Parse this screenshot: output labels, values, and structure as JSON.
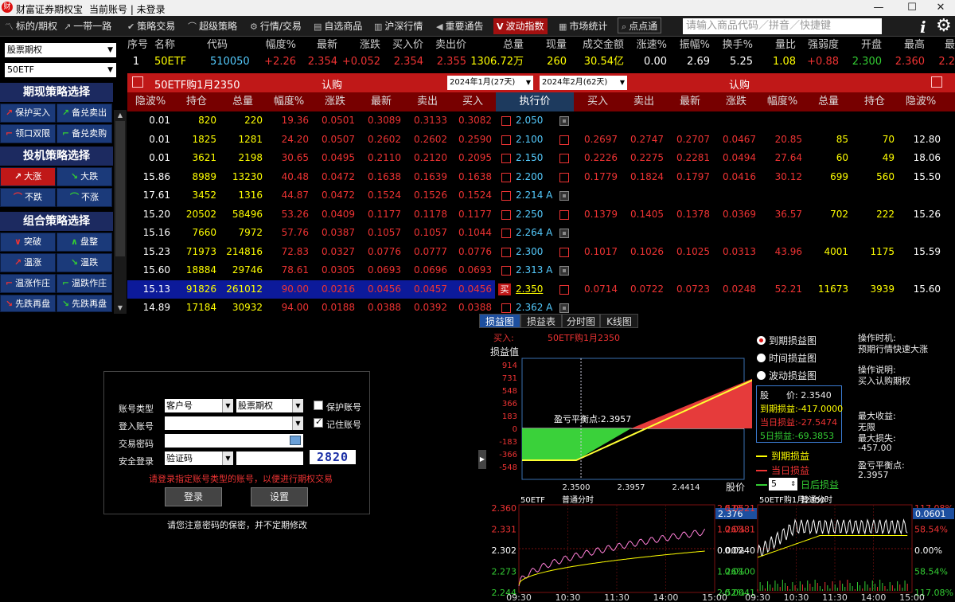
{
  "titlebar": {
    "app_name": "财富证券期权宝",
    "account": "当前账号 | 未登录"
  },
  "toolbar": {
    "items": [
      {
        "label": "标的/期权",
        "icon": "chart-line"
      },
      {
        "label": "一带一路",
        "icon": "trend"
      },
      {
        "label": "策略交易",
        "icon": "check"
      },
      {
        "label": "超级策略",
        "icon": "trend"
      },
      {
        "label": "行情/交易",
        "icon": "gear"
      },
      {
        "label": "自选商品",
        "icon": "cart"
      },
      {
        "label": "沪深行情",
        "icon": "bars"
      },
      {
        "label": "重要通告",
        "icon": "speaker"
      },
      {
        "label": "波动指数",
        "icon": "V"
      },
      {
        "label": "市场统计",
        "icon": "building"
      },
      {
        "label": "点点通",
        "icon": "search"
      }
    ],
    "search_placeholder": "请输入商品代码／拼音／快捷键"
  },
  "left": {
    "select1": "股票期权",
    "select2": "50ETF",
    "group1": {
      "title": "期现策略选择",
      "buttons": [
        "保护买入",
        "备兑卖出",
        "领口双限",
        "备兑卖购"
      ]
    },
    "group2": {
      "title": "投机策略选择",
      "buttons": [
        "大涨",
        "大跌",
        "不跌",
        "不涨"
      ]
    },
    "group3": {
      "title": "组合策略选择",
      "buttons": [
        "突破",
        "盘整",
        "温涨",
        "温跌",
        "温涨作庄",
        "温跌作庄",
        "先跌再盘",
        "先跌再盘"
      ]
    }
  },
  "quote": {
    "headers": [
      "序号",
      "名称",
      "代码",
      "幅度%",
      "最新",
      "涨跌",
      "买入价",
      "卖出价",
      "总量",
      "现量",
      "成交金额",
      "涨速%",
      "振幅%",
      "换手%",
      "量比",
      "强弱度",
      "开盘",
      "最高",
      "最"
    ],
    "row": [
      "1",
      "50ETF",
      "510050",
      "+2.26",
      "2.354",
      "+0.052",
      "2.354",
      "2.355",
      "1306.72万",
      "260",
      "30.54亿",
      "0.00",
      "2.69",
      "5.25",
      "1.08",
      "+0.88",
      "2.300",
      "2.360",
      "2.2"
    ]
  },
  "option_bar": {
    "title": "50ETF购1月2350",
    "left_type": "认购",
    "month1": "2024年1月(27天)",
    "month2": "2024年2月(62天)",
    "right_type": "认购"
  },
  "chain": {
    "headers_left": [
      "隐波%",
      "持仓",
      "总量",
      "幅度%",
      "涨跌",
      "最新",
      "卖出",
      "买入"
    ],
    "header_strike": "执行价",
    "headers_right": [
      "买入",
      "卖出",
      "最新",
      "涨跌",
      "幅度%",
      "总量",
      "持仓",
      "隐波%"
    ],
    "rows": [
      {
        "left": [
          "0.01",
          "820",
          "220",
          "19.36",
          "0.0501",
          "0.3089",
          "0.3133",
          "0.3082"
        ],
        "strike": "2.050",
        "right": [
          "",
          "",
          "",
          "",
          "",
          "",
          "",
          ""
        ],
        "sel": false,
        "buy": ""
      },
      {
        "left": [
          "0.01",
          "1825",
          "1281",
          "24.20",
          "0.0507",
          "0.2602",
          "0.2602",
          "0.2590"
        ],
        "strike": "2.100",
        "right": [
          "0.2697",
          "0.2747",
          "0.2707",
          "0.0467",
          "20.85",
          "85",
          "70",
          "12.80"
        ],
        "sel": false,
        "buy": ""
      },
      {
        "left": [
          "0.01",
          "3621",
          "2198",
          "30.65",
          "0.0495",
          "0.2110",
          "0.2120",
          "0.2095"
        ],
        "strike": "2.150",
        "right": [
          "0.2226",
          "0.2275",
          "0.2281",
          "0.0494",
          "27.64",
          "60",
          "49",
          "18.06"
        ],
        "sel": false,
        "buy": ""
      },
      {
        "left": [
          "15.86",
          "8989",
          "13230",
          "40.48",
          "0.0472",
          "0.1638",
          "0.1639",
          "0.1638"
        ],
        "strike": "2.200",
        "right": [
          "0.1779",
          "0.1824",
          "0.1797",
          "0.0416",
          "30.12",
          "699",
          "560",
          "15.50"
        ],
        "sel": false,
        "buy": ""
      },
      {
        "left": [
          "17.61",
          "3452",
          "1316",
          "44.87",
          "0.0472",
          "0.1524",
          "0.1526",
          "0.1524"
        ],
        "strike": "2.214 A",
        "right": [
          "",
          "",
          "",
          "",
          "",
          "",
          "",
          ""
        ],
        "sel": false,
        "buy": ""
      },
      {
        "left": [
          "15.20",
          "20502",
          "58496",
          "53.26",
          "0.0409",
          "0.1177",
          "0.1178",
          "0.1177"
        ],
        "strike": "2.250",
        "right": [
          "0.1379",
          "0.1405",
          "0.1378",
          "0.0369",
          "36.57",
          "702",
          "222",
          "15.26"
        ],
        "sel": false,
        "buy": ""
      },
      {
        "left": [
          "15.16",
          "7660",
          "7972",
          "57.76",
          "0.0387",
          "0.1057",
          "0.1057",
          "0.1044"
        ],
        "strike": "2.264 A",
        "right": [
          "",
          "",
          "",
          "",
          "",
          "",
          "",
          ""
        ],
        "sel": false,
        "buy": ""
      },
      {
        "left": [
          "15.23",
          "71973",
          "214816",
          "72.83",
          "0.0327",
          "0.0776",
          "0.0777",
          "0.0776"
        ],
        "strike": "2.300",
        "right": [
          "0.1017",
          "0.1026",
          "0.1025",
          "0.0313",
          "43.96",
          "4001",
          "1175",
          "15.59"
        ],
        "sel": false,
        "buy": ""
      },
      {
        "left": [
          "15.60",
          "18884",
          "29746",
          "78.61",
          "0.0305",
          "0.0693",
          "0.0696",
          "0.0693"
        ],
        "strike": "2.313 A",
        "right": [
          "",
          "",
          "",
          "",
          "",
          "",
          "",
          ""
        ],
        "sel": false,
        "buy": ""
      },
      {
        "left": [
          "15.13",
          "91826",
          "261012",
          "90.00",
          "0.0216",
          "0.0456",
          "0.0457",
          "0.0456"
        ],
        "strike": "2.350",
        "right": [
          "0.0714",
          "0.0722",
          "0.0723",
          "0.0248",
          "52.21",
          "11673",
          "3939",
          "15.60"
        ],
        "sel": true,
        "buy": "买"
      },
      {
        "left": [
          "14.89",
          "17184",
          "30932",
          "94.00",
          "0.0188",
          "0.0388",
          "0.0392",
          "0.0388"
        ],
        "strike": "2.362 A",
        "right": [
          "",
          "",
          "",
          "",
          "",
          "",
          "",
          ""
        ],
        "sel": false,
        "buy": ""
      }
    ]
  },
  "tabs": [
    "损益图",
    "损益表",
    "分时图",
    "K线图"
  ],
  "pl": {
    "title_prefix": "买入:",
    "title_contract": "50ETF购1月2350",
    "ylabel": "损益值",
    "xlabel": "股价",
    "yticks": [
      "914",
      "731",
      "548",
      "366",
      "183",
      "0",
      "-183",
      "-366",
      "-548"
    ],
    "xticks": [
      "2.3500",
      "2.3957",
      "2.4414"
    ],
    "breakeven_label": "盈亏平衡点:2.3957",
    "radio": [
      "到期损益图",
      "时间损益图",
      "波动损益图"
    ],
    "box": {
      "price_label": "股　　价:",
      "price": "2.3540",
      "expiry_label": "到期损益:",
      "expiry": "-417.0000",
      "today_label": "当日损益:",
      "today": "-27.5474",
      "five_label": "5日损益:",
      "five": "-69.3853"
    },
    "legend": [
      "到期损益",
      "当日损益",
      "日后损益"
    ],
    "spin": "5",
    "colors": {
      "loss": "#3ad13a",
      "gain": "#e63b3b",
      "expiry_line": "#ffff33",
      "today_line": "#e63b3b",
      "future_line": "#3ad13a"
    }
  },
  "notes": {
    "time_label": "操作时机:",
    "time_text": "预期行情快速大涨",
    "desc_label": "操作说明:",
    "desc_text": "买入认购期权",
    "max_gain_label": "最大收益:",
    "max_gain": "无限",
    "max_loss_label": "最大损失:",
    "max_loss": "-457.00",
    "be_label": "盈亏平衡点:",
    "be_value": "2.3957"
  },
  "mini1": {
    "name": "50ETF",
    "mode": "普通分时",
    "yl": [
      "2.360",
      "2.331",
      "2.302",
      "2.273",
      "2.244"
    ],
    "yr": [
      "2.52%",
      "1.26%",
      "0.00%",
      "1.26%",
      "2.52%"
    ],
    "last": "2.376",
    "xt": [
      "09:30",
      "10:30",
      "11:30",
      "14:00",
      "15:00"
    ]
  },
  "mini2": {
    "name": "50ETF购1月2350",
    "mode": "普通分时",
    "yl": [
      "0.0521",
      "0.0381",
      "0.0240",
      "0.0100",
      "-0.0041"
    ],
    "yr": [
      "117.08%",
      "58.54%",
      "0.00%",
      "58.54%",
      "117.08%"
    ],
    "last": "0.0601",
    "xt": [
      "09:30",
      "10:30",
      "11:30",
      "14:00",
      "15:00"
    ]
  },
  "login": {
    "acct_type_label": "账号类型",
    "acct_type": "客户号",
    "acct_market": "股票期权",
    "protect_label": "保护账号",
    "login_acct_label": "登入账号",
    "remember_label": "记住账号",
    "pwd_label": "交易密码",
    "security_label": "安全登录",
    "security_value": "验证码",
    "captcha": "2820",
    "warning": "请登录指定账号类型的账号，以便进行期权交易",
    "login_btn": "登录",
    "settings_btn": "设置",
    "footer": "请您注意密码的保密，并不定期修改"
  }
}
